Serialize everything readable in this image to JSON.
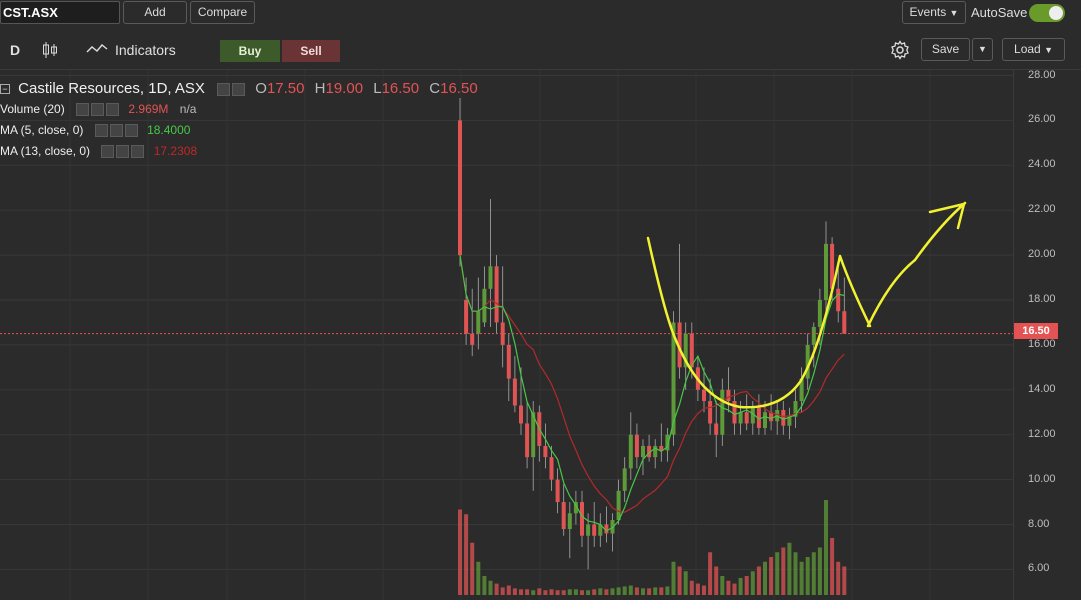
{
  "topbar": {
    "symbol": "CST.ASX",
    "add_label": "Add",
    "compare_label": "Compare",
    "events_label": "Events",
    "autosave_label": "AutoSave",
    "autosave_on": true
  },
  "toolbar": {
    "interval": "D",
    "indicators_label": "Indicators",
    "buy_label": "Buy",
    "sell_label": "Sell",
    "save_label": "Save",
    "load_label": "Load"
  },
  "legend": {
    "title": "Castile Resources, 1D, ASX",
    "o_label": "O",
    "o_value": "17.50",
    "h_label": "H",
    "h_value": "19.00",
    "l_label": "L",
    "l_value": "16.50",
    "c_label": "C",
    "c_value": "16.50",
    "volume_label": "Volume (20)",
    "volume_value": "2.969M",
    "volume_na": "n/a",
    "ma5_label": "MA (5, close, 0)",
    "ma5_value": "18.4000",
    "ma13_label": "MA (13, close, 0)",
    "ma13_value": "17.2308"
  },
  "axis": {
    "ticks": [
      "28.00",
      "26.00",
      "24.00",
      "22.00",
      "20.00",
      "18.00",
      "16.00",
      "14.00",
      "12.00",
      "10.00",
      "8.00",
      "6.00"
    ],
    "current_price": "16.50"
  },
  "colors": {
    "up": "#5f9a3a",
    "down": "#e15454",
    "ma5": "#46c846",
    "ma13": "#b22a2a",
    "annotation": "#f2f230"
  },
  "chart_data": {
    "type": "candlestick",
    "ylim": [
      5,
      28
    ],
    "candles": [
      {
        "o": 26.0,
        "h": 27.0,
        "l": 19.5,
        "c": 20.0
      },
      {
        "o": 18.0,
        "h": 19.0,
        "l": 16.0,
        "c": 16.5
      },
      {
        "o": 16.5,
        "h": 18.5,
        "l": 15.5,
        "c": 16.0
      },
      {
        "o": 16.5,
        "h": 19.0,
        "l": 15.8,
        "c": 17.5
      },
      {
        "o": 17.0,
        "h": 19.5,
        "l": 16.8,
        "c": 18.5
      },
      {
        "o": 18.5,
        "h": 22.5,
        "l": 16.8,
        "c": 19.5
      },
      {
        "o": 19.5,
        "h": 20.0,
        "l": 16.5,
        "c": 17.0
      },
      {
        "o": 17.0,
        "h": 19.5,
        "l": 15.0,
        "c": 16.0
      },
      {
        "o": 16.0,
        "h": 16.5,
        "l": 13.5,
        "c": 14.5
      },
      {
        "o": 14.5,
        "h": 15.5,
        "l": 13.0,
        "c": 13.3
      },
      {
        "o": 13.3,
        "h": 15.0,
        "l": 12.0,
        "c": 12.5
      },
      {
        "o": 12.5,
        "h": 13.5,
        "l": 10.5,
        "c": 11.0
      },
      {
        "o": 11.0,
        "h": 13.5,
        "l": 9.5,
        "c": 13.0
      },
      {
        "o": 13.0,
        "h": 13.3,
        "l": 10.8,
        "c": 11.5
      },
      {
        "o": 11.5,
        "h": 12.5,
        "l": 10.5,
        "c": 11.0
      },
      {
        "o": 11.0,
        "h": 11.5,
        "l": 9.5,
        "c": 10.0
      },
      {
        "o": 10.0,
        "h": 10.5,
        "l": 8.5,
        "c": 9.0
      },
      {
        "o": 9.0,
        "h": 9.8,
        "l": 7.5,
        "c": 7.8
      },
      {
        "o": 7.8,
        "h": 9.0,
        "l": 6.5,
        "c": 8.5
      },
      {
        "o": 8.5,
        "h": 9.5,
        "l": 8.0,
        "c": 9.0
      },
      {
        "o": 9.0,
        "h": 9.5,
        "l": 7.0,
        "c": 7.5
      },
      {
        "o": 7.5,
        "h": 8.5,
        "l": 6.0,
        "c": 8.0
      },
      {
        "o": 8.0,
        "h": 9.0,
        "l": 7.0,
        "c": 7.5
      },
      {
        "o": 7.5,
        "h": 8.5,
        "l": 7.0,
        "c": 8.0
      },
      {
        "o": 8.0,
        "h": 8.8,
        "l": 7.2,
        "c": 7.6
      },
      {
        "o": 7.6,
        "h": 8.5,
        "l": 6.8,
        "c": 8.2
      },
      {
        "o": 8.2,
        "h": 10.0,
        "l": 8.0,
        "c": 9.5
      },
      {
        "o": 9.5,
        "h": 11.0,
        "l": 9.0,
        "c": 10.5
      },
      {
        "o": 10.5,
        "h": 13.0,
        "l": 10.0,
        "c": 12.0
      },
      {
        "o": 12.0,
        "h": 12.5,
        "l": 10.5,
        "c": 11.0
      },
      {
        "o": 11.0,
        "h": 11.8,
        "l": 10.2,
        "c": 11.5
      },
      {
        "o": 11.5,
        "h": 12.0,
        "l": 10.8,
        "c": 11.0
      },
      {
        "o": 11.0,
        "h": 11.8,
        "l": 10.5,
        "c": 11.5
      },
      {
        "o": 11.5,
        "h": 12.5,
        "l": 10.8,
        "c": 11.3
      },
      {
        "o": 11.3,
        "h": 12.3,
        "l": 10.8,
        "c": 12.0
      },
      {
        "o": 12.0,
        "h": 17.5,
        "l": 11.5,
        "c": 17.0
      },
      {
        "o": 17.0,
        "h": 20.5,
        "l": 14.5,
        "c": 15.0
      },
      {
        "o": 15.0,
        "h": 17.0,
        "l": 14.0,
        "c": 16.5
      },
      {
        "o": 16.5,
        "h": 17.0,
        "l": 14.5,
        "c": 15.0
      },
      {
        "o": 15.0,
        "h": 15.5,
        "l": 13.5,
        "c": 14.0
      },
      {
        "o": 14.0,
        "h": 15.0,
        "l": 13.0,
        "c": 13.5
      },
      {
        "o": 13.5,
        "h": 14.5,
        "l": 12.0,
        "c": 12.5
      },
      {
        "o": 12.5,
        "h": 13.5,
        "l": 11.0,
        "c": 12.0
      },
      {
        "o": 12.0,
        "h": 14.5,
        "l": 11.5,
        "c": 14.0
      },
      {
        "o": 14.0,
        "h": 15.0,
        "l": 13.0,
        "c": 13.5
      },
      {
        "o": 13.5,
        "h": 14.0,
        "l": 12.0,
        "c": 12.5
      },
      {
        "o": 12.5,
        "h": 13.5,
        "l": 12.0,
        "c": 13.0
      },
      {
        "o": 13.0,
        "h": 13.8,
        "l": 12.2,
        "c": 12.5
      },
      {
        "o": 12.5,
        "h": 13.5,
        "l": 12.0,
        "c": 13.2
      },
      {
        "o": 13.2,
        "h": 13.8,
        "l": 12.0,
        "c": 12.3
      },
      {
        "o": 12.3,
        "h": 13.5,
        "l": 12.0,
        "c": 13.0
      },
      {
        "o": 13.0,
        "h": 13.8,
        "l": 12.2,
        "c": 12.6
      },
      {
        "o": 12.6,
        "h": 13.5,
        "l": 12.0,
        "c": 13.1
      },
      {
        "o": 13.1,
        "h": 13.5,
        "l": 12.0,
        "c": 12.4
      },
      {
        "o": 12.4,
        "h": 13.2,
        "l": 11.8,
        "c": 12.8
      },
      {
        "o": 12.8,
        "h": 14.0,
        "l": 12.3,
        "c": 13.5
      },
      {
        "o": 13.5,
        "h": 15.0,
        "l": 13.0,
        "c": 14.5
      },
      {
        "o": 14.5,
        "h": 16.5,
        "l": 14.0,
        "c": 16.0
      },
      {
        "o": 16.0,
        "h": 17.0,
        "l": 15.0,
        "c": 16.8
      },
      {
        "o": 16.8,
        "h": 18.5,
        "l": 16.0,
        "c": 18.0
      },
      {
        "o": 18.0,
        "h": 21.5,
        "l": 17.5,
        "c": 20.5
      },
      {
        "o": 20.5,
        "h": 20.8,
        "l": 18.0,
        "c": 18.5
      },
      {
        "o": 18.5,
        "h": 19.5,
        "l": 17.0,
        "c": 17.5
      },
      {
        "o": 17.5,
        "h": 19.0,
        "l": 16.5,
        "c": 16.5
      }
    ],
    "volume": [
      0.9,
      0.85,
      0.55,
      0.35,
      0.2,
      0.15,
      0.12,
      0.08,
      0.1,
      0.07,
      0.06,
      0.06,
      0.05,
      0.07,
      0.05,
      0.06,
      0.05,
      0.05,
      0.06,
      0.06,
      0.05,
      0.05,
      0.06,
      0.07,
      0.06,
      0.07,
      0.08,
      0.09,
      0.1,
      0.08,
      0.07,
      0.07,
      0.08,
      0.08,
      0.09,
      0.35,
      0.3,
      0.25,
      0.15,
      0.12,
      0.1,
      0.45,
      0.3,
      0.2,
      0.15,
      0.12,
      0.18,
      0.2,
      0.25,
      0.3,
      0.35,
      0.4,
      0.45,
      0.5,
      0.55,
      0.45,
      0.35,
      0.4,
      0.45,
      0.5,
      1.0,
      0.6,
      0.35,
      0.3
    ]
  }
}
